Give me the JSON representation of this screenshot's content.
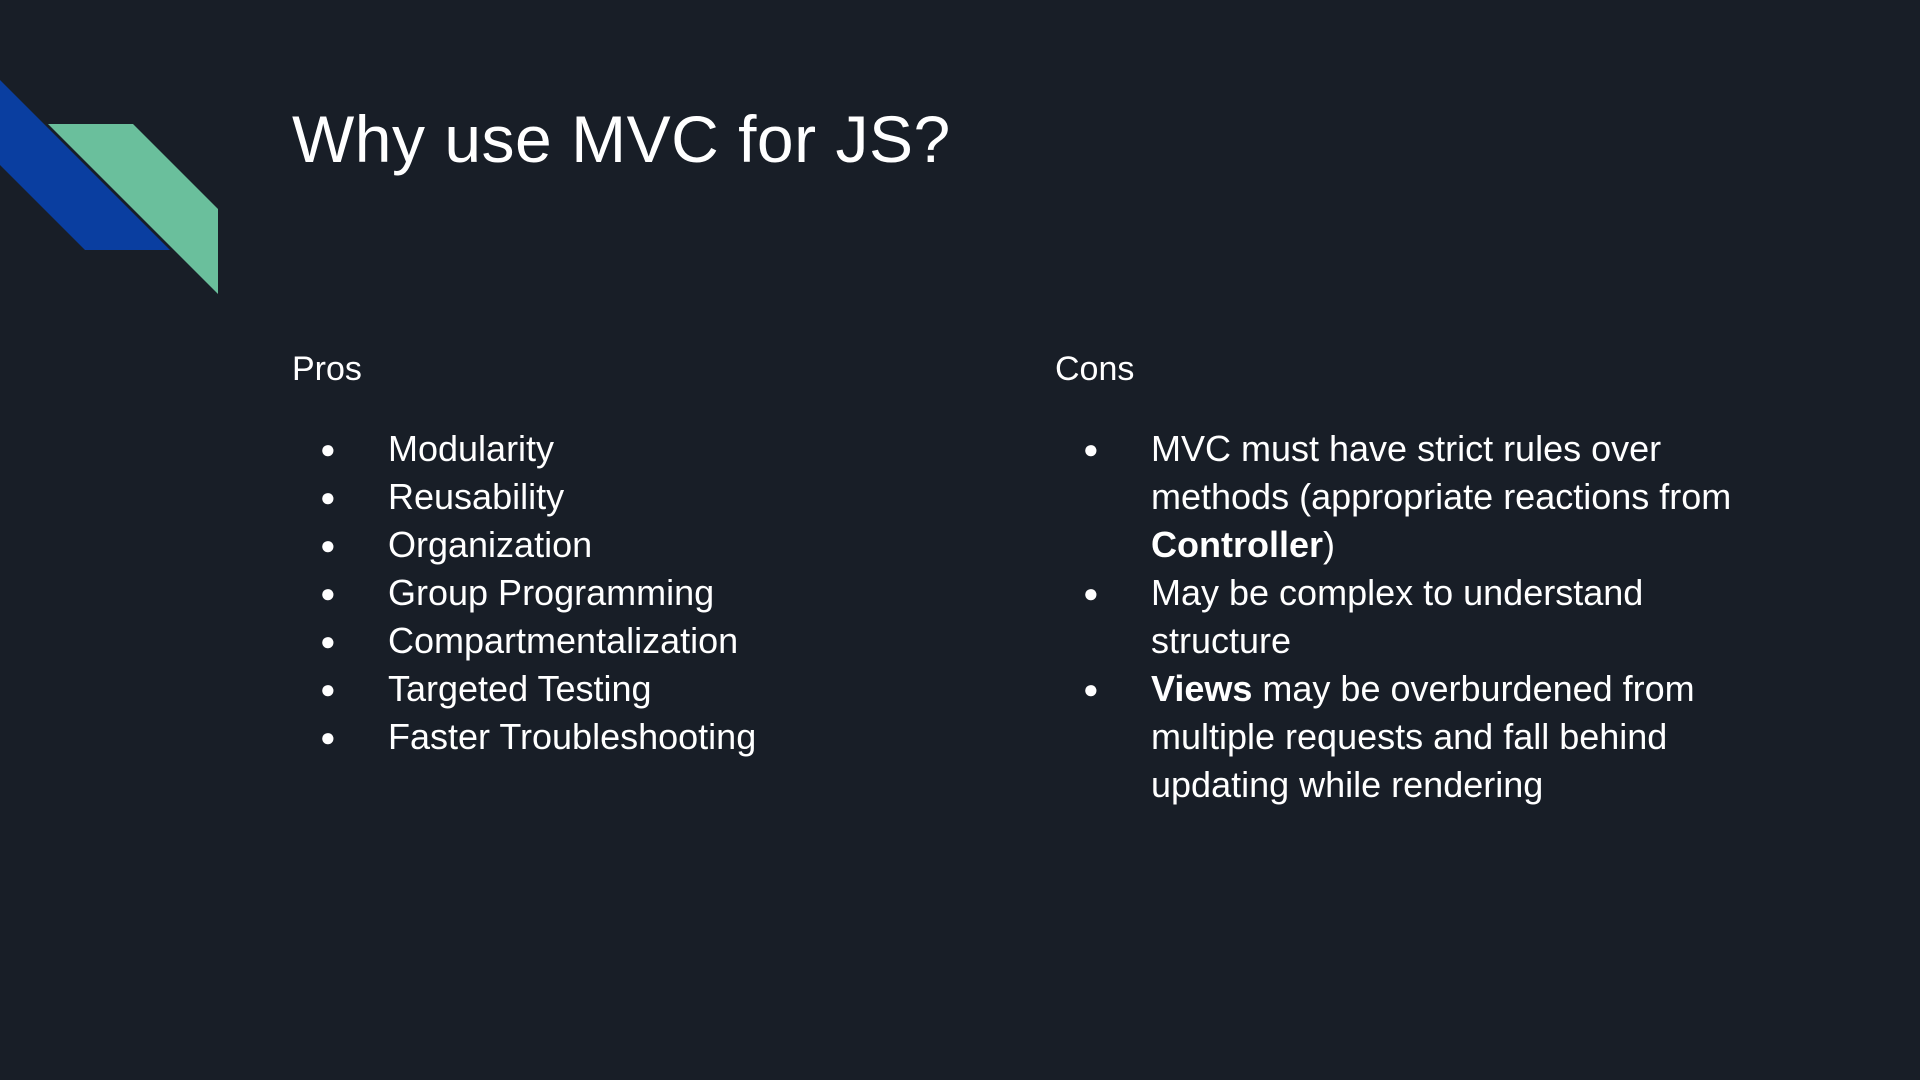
{
  "slide": {
    "title": "Why use MVC for JS?",
    "colors": {
      "background": "#181e27",
      "accent_blue": "#0a3ea0",
      "accent_green": "#6abf9c"
    }
  },
  "pros": {
    "heading": "Pros",
    "items": [
      "Modularity",
      "Reusability",
      "Organization",
      "Group Programming",
      "Compartmentalization",
      "Targeted Testing",
      "Faster Troubleshooting"
    ]
  },
  "cons": {
    "heading": "Cons",
    "items": [
      {
        "pre": "MVC must have strict rules over methods (appropriate reactions from ",
        "bold": "Controller",
        "post": ")"
      },
      {
        "pre": "May be complex to understand structure",
        "bold": "",
        "post": ""
      },
      {
        "pre": "",
        "bold": "Views",
        "post": " may be overburdened from multiple requests and fall behind updating while rendering"
      }
    ]
  },
  "bullet_glyph": "●"
}
